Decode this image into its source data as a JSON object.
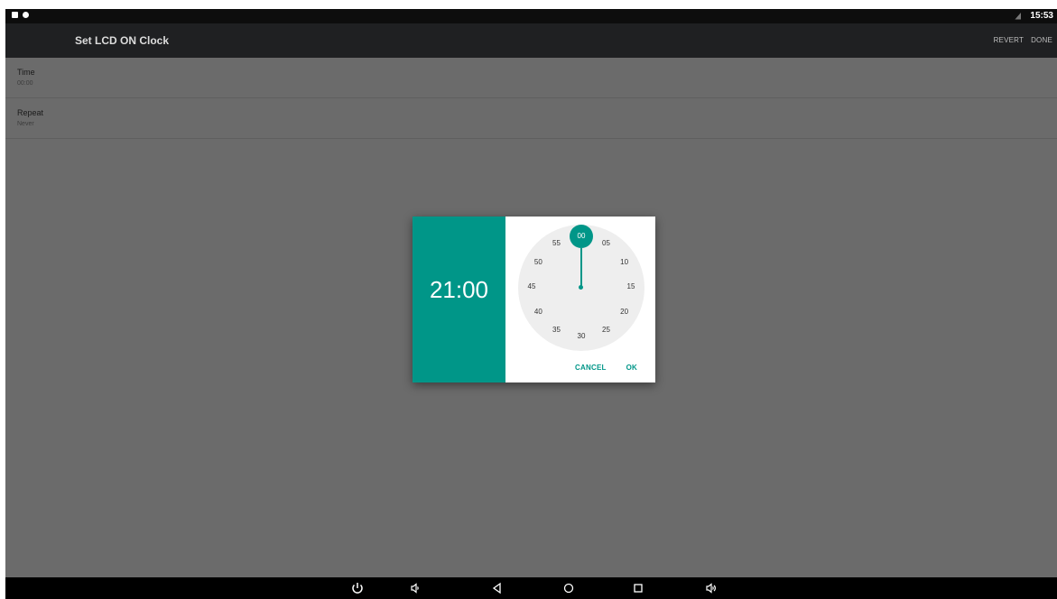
{
  "status_bar": {
    "time": "15:53"
  },
  "app_bar": {
    "title": "Set LCD ON Clock",
    "revert_label": "REVERT",
    "done_label": "DONE"
  },
  "preferences": [
    {
      "title": "Time",
      "summary": "00:00"
    },
    {
      "title": "Repeat",
      "summary": "Never"
    }
  ],
  "time_picker": {
    "time_display": "21:00",
    "selected_minute": "00",
    "minute_ticks": [
      "05",
      "10",
      "15",
      "20",
      "25",
      "30",
      "35",
      "40",
      "45",
      "50",
      "55"
    ],
    "cancel_label": "CANCEL",
    "ok_label": "OK",
    "accent_color": "#009688"
  },
  "nav_bar": {
    "icons": [
      "power-icon",
      "volume-down-icon",
      "back-icon",
      "home-icon",
      "recents-icon",
      "volume-up-icon"
    ]
  }
}
